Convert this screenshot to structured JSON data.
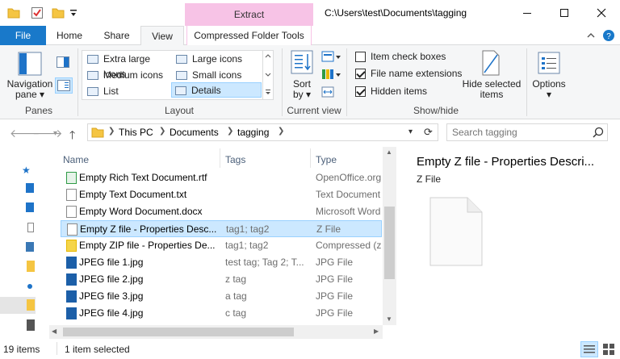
{
  "titlebar": {
    "context_tab": "Extract",
    "path_title": "C:\\Users\\test\\Documents\\tagging"
  },
  "tabs": {
    "file": "File",
    "home": "Home",
    "share": "Share",
    "view": "View",
    "compressed": "Compressed Folder Tools"
  },
  "ribbon": {
    "panes": {
      "nav_pane_l1": "Navigation",
      "nav_pane_l2": "pane",
      "group": "Panes"
    },
    "layout": {
      "items": [
        "Extra large icons",
        "Large icons",
        "Medium icons",
        "Small icons",
        "List",
        "Details"
      ],
      "selected": "Details",
      "group": "Layout"
    },
    "current_view": {
      "sort_l1": "Sort",
      "sort_l2": "by",
      "group": "Current view"
    },
    "show_hide": {
      "item_check_boxes": "Item check boxes",
      "file_name_extensions": "File name extensions",
      "hidden_items": "Hidden items",
      "item_check_boxes_checked": false,
      "file_name_extensions_checked": true,
      "hidden_items_checked": true,
      "hide_selected_l1": "Hide selected",
      "hide_selected_l2": "items",
      "group": "Show/hide"
    },
    "options": "Options"
  },
  "address": {
    "crumbs": [
      "This PC",
      "Documents",
      "tagging"
    ],
    "search_placeholder": "Search tagging"
  },
  "columns": {
    "name": "Name",
    "tags": "Tags",
    "type": "Type"
  },
  "files": [
    {
      "name": "Empty Rich Text Document.rtf",
      "tags": "",
      "type": "OpenOffice.org",
      "icon": "rtf-file-icon",
      "color": "#2e9b45"
    },
    {
      "name": "Empty Text Document.txt",
      "tags": "",
      "type": "Text Document",
      "icon": "txt-file-icon",
      "color": "#8a8a8a"
    },
    {
      "name": "Empty Word Document.docx",
      "tags": "",
      "type": "Microsoft Word",
      "icon": "docx-file-icon",
      "color": "#8a8a8a"
    },
    {
      "name": "Empty Z file - Properties Desc...",
      "tags": "tag1; tag2",
      "type": "Z File",
      "icon": "blank-file-icon",
      "color": "#8a8a8a",
      "selected": true
    },
    {
      "name": "Empty ZIP file - Properties De...",
      "tags": "tag1; tag2",
      "type": "Compressed (zi",
      "icon": "zip-folder-icon",
      "color": "#e6b800"
    },
    {
      "name": "JPEG file 1.jpg",
      "tags": "test tag; Tag 2; T...",
      "type": "JPG File",
      "icon": "jpg-file-icon",
      "color": "#1c5fa8"
    },
    {
      "name": "JPEG file 2.jpg",
      "tags": "z tag",
      "type": "JPG File",
      "icon": "jpg-file-icon",
      "color": "#1c5fa8"
    },
    {
      "name": "JPEG file 3.jpg",
      "tags": "a tag",
      "type": "JPG File",
      "icon": "jpg-file-icon",
      "color": "#1c5fa8"
    },
    {
      "name": "JPEG file 4.jpg",
      "tags": "c tag",
      "type": "JPG File",
      "icon": "jpg-file-icon",
      "color": "#1c5fa8"
    }
  ],
  "preview": {
    "title": "Empty Z file - Properties Descri...",
    "subtitle": "Z File"
  },
  "status": {
    "items_count": "19 items",
    "selected": "1 item selected"
  },
  "colors": {
    "file_tab": "#1979ca",
    "context_tab": "#f7c3e6",
    "selection": "#cce8ff",
    "selection_border": "#99d1ff"
  }
}
